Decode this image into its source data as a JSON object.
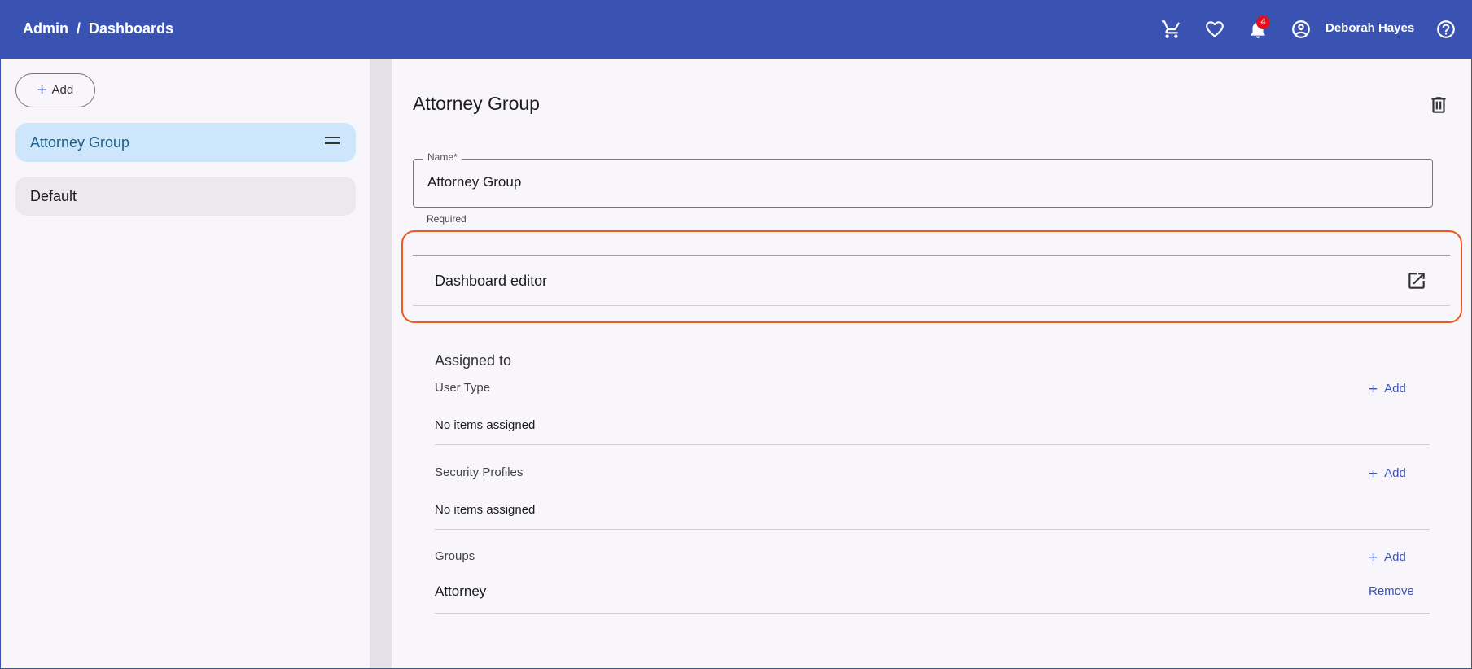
{
  "header": {
    "breadcrumb": [
      "Admin",
      "Dashboards"
    ],
    "separator": "/",
    "notification_count": "4",
    "user_name": "Deborah Hayes",
    "icons": [
      "cart-icon",
      "heart-icon",
      "bell-icon",
      "account-circle-icon",
      "help-icon"
    ]
  },
  "sidebar": {
    "add_label": "Add",
    "items": [
      {
        "label": "Attorney Group",
        "active": true
      },
      {
        "label": "Default",
        "active": false
      }
    ]
  },
  "main": {
    "title": "Attorney Group",
    "name_field": {
      "label": "Name*",
      "value": "Attorney Group",
      "helper": "Required"
    },
    "dashboard_editor_label": "Dashboard editor",
    "assigned_to": {
      "title": "Assigned to",
      "add_label": "Add",
      "sections": [
        {
          "label": "User Type",
          "empty_text": "No items assigned"
        },
        {
          "label": "Security Profiles",
          "empty_text": "No items assigned"
        },
        {
          "label": "Groups",
          "items": [
            {
              "name": "Attorney",
              "action": "Remove"
            }
          ]
        }
      ]
    }
  },
  "colors": {
    "header_bg": "#3a53b3",
    "accent": "#3a53b3",
    "active_item_bg": "#cde6fb",
    "highlight_border": "#ea5a22",
    "badge": "#e0121f"
  }
}
